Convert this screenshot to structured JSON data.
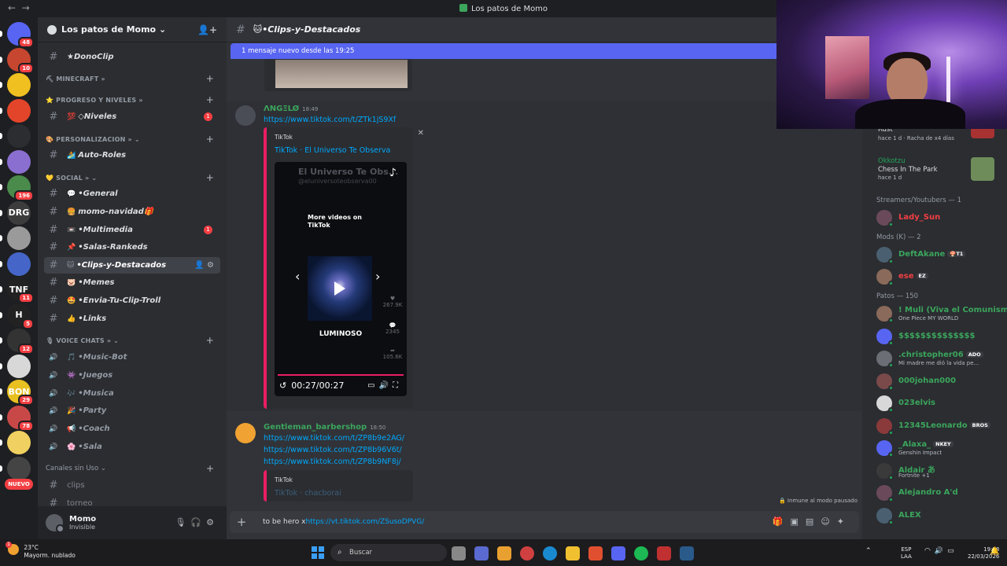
{
  "window": {
    "title": "Los patos de Momo"
  },
  "servers": [
    {
      "label": "",
      "badge": "48",
      "color": "#5865f2"
    },
    {
      "label": "",
      "badge": "10",
      "color": "#c7462f"
    },
    {
      "label": "",
      "badge": "",
      "color": "#f0c020"
    },
    {
      "label": "",
      "badge": "",
      "color": "#e3452a"
    },
    {
      "label": "",
      "badge": "",
      "color": "#2b2d31"
    },
    {
      "label": "",
      "badge": "",
      "color": "#8a6fd0"
    },
    {
      "label": "",
      "badge": "196",
      "color": "#4a8a4a"
    },
    {
      "label": "DRG",
      "badge": "",
      "color": "#3c3c3c"
    },
    {
      "label": "",
      "badge": "",
      "color": "#9a9a9a"
    },
    {
      "label": "",
      "badge": "",
      "color": "#4566c8"
    },
    {
      "label": "TNF",
      "badge": "11",
      "color": "#222"
    },
    {
      "label": "H",
      "badge": "5",
      "color": "#222"
    },
    {
      "label": "",
      "badge": "12",
      "color": "#333"
    },
    {
      "label": "",
      "badge": "",
      "color": "#d8d8d8"
    },
    {
      "label": "BON",
      "badge": "29",
      "color": "#e8c020"
    },
    {
      "label": "",
      "badge": "78",
      "color": "#c84848"
    },
    {
      "label": "",
      "badge": "",
      "color": "#f0d060"
    },
    {
      "label": "",
      "badge": "",
      "color": "#444"
    }
  ],
  "nuevo_label": "NUEVO",
  "guild": {
    "name": "Los patos de Momo ⌄"
  },
  "channels": {
    "items": [
      {
        "type": "text",
        "emoji": "",
        "name": "★DonoClip",
        "badge": ""
      },
      {
        "type": "cat",
        "name": "⛏ MINECRAFT »"
      },
      {
        "type": "cat",
        "name": "⭐ PROGRESO Y NIVELES »"
      },
      {
        "type": "text",
        "emoji": "💯",
        "name": "◇Niveles",
        "badge": "1"
      },
      {
        "type": "cat",
        "name": "🎨 PERSONALIZACION » ⌄"
      },
      {
        "type": "text",
        "emoji": "🏄",
        "name": "Auto-Roles",
        "badge": ""
      },
      {
        "type": "cat",
        "name": "💛 SOCIAL » ⌄"
      },
      {
        "type": "text",
        "emoji": "💬",
        "name": "•General",
        "badge": ""
      },
      {
        "type": "text",
        "emoji": "🍔",
        "name": "momo-navidad🎁",
        "badge": ""
      },
      {
        "type": "text",
        "emoji": "📼",
        "name": "•Multimedia",
        "badge": "1"
      },
      {
        "type": "text",
        "emoji": "📌",
        "name": "•Salas-Rankeds",
        "badge": ""
      },
      {
        "type": "text",
        "emoji": "🐱",
        "name": "•Clips-y-Destacados",
        "badge": "",
        "active": true
      },
      {
        "type": "text",
        "emoji": "🐷",
        "name": "•Memes",
        "badge": ""
      },
      {
        "type": "text",
        "emoji": "🤩",
        "name": "•Envia-Tu-Clip-Troll",
        "badge": ""
      },
      {
        "type": "text",
        "emoji": "👍",
        "name": "•Links",
        "badge": ""
      },
      {
        "type": "cat",
        "name": "🎙 VOICE CHATS » ⌄"
      },
      {
        "type": "voice",
        "emoji": "🎵",
        "name": "•Music-Bot"
      },
      {
        "type": "voice",
        "emoji": "👾",
        "name": "•Juegos"
      },
      {
        "type": "voice",
        "emoji": "🎶",
        "name": "•Musica"
      },
      {
        "type": "voice",
        "emoji": "🎉",
        "name": "•Party"
      },
      {
        "type": "voice",
        "emoji": "📢",
        "name": "•Coach"
      },
      {
        "type": "voice",
        "emoji": "🌸",
        "name": "•Sala"
      },
      {
        "type": "catplain",
        "name": "Canales sin Uso ⌄"
      },
      {
        "type": "text",
        "emoji": "",
        "name": "clips",
        "badge": "",
        "plain": true
      },
      {
        "type": "text",
        "emoji": "",
        "name": "torneo",
        "badge": "",
        "plain": true
      }
    ]
  },
  "user": {
    "name": "Momo",
    "status": "Invisible"
  },
  "channel_header": {
    "emoji": "🐱",
    "name": "•Clips-y-Destacados"
  },
  "new_messages_bar": "1 mensaje nuevo desde las 19:25",
  "messages": [
    {
      "author": "ΛNGΞLØ",
      "time": "18:49",
      "link": "https://www.tiktok.com/t/ZTk1jS9Xf",
      "embed": {
        "provider": "TikTok",
        "title": "TikTok · El Universo Te Observa",
        "video": {
          "title": "El Universo Te Obs...",
          "handle": "@eluniversoteobserva00",
          "more": "More videos on TikTok",
          "caption": "LUMINOSO",
          "likes": "267.9K",
          "comments": "2345",
          "shares": "105.6K",
          "time": "00:27/00:27",
          "progress": 1.0
        }
      }
    },
    {
      "author": "Gentleman_barbershop",
      "time": "18:50",
      "links": [
        "https://www.tiktok.com/t/ZP8b9e2AG/",
        "https://www.tiktok.com/t/ZP8b96V6t/",
        "https://www.tiktok.com/t/ZP8b9NF8j/"
      ],
      "embed": {
        "provider": "TikTok",
        "title": "TikTok · chacborai"
      }
    }
  ],
  "paused_notice": "Inmune al modo pausado",
  "composer": {
    "prefix": "to be hero x",
    "url": "https://vt.tiktok.com/ZSusoDPVG/"
  },
  "members": {
    "activity_cards": [
      {
        "name": "Rust",
        "game": "",
        "time": "hace 1 d",
        "extra": "Racha de x4 días"
      },
      {
        "name": "Okkotzu",
        "game": "Chess In The Park",
        "time": "hace 1 d"
      }
    ],
    "groups": [
      {
        "heading": "Streamers/Youtubers — 1",
        "members": [
          {
            "name": "Lady_Sun",
            "color": "#f23f43",
            "activity": "",
            "tag": ""
          }
        ]
      },
      {
        "heading": "Mods (K) — 2",
        "members": [
          {
            "name": "DeftAkane",
            "color": "#3ba55c",
            "activity": "",
            "tag": "🍄T1"
          },
          {
            "name": "ese",
            "color": "#f23f43",
            "activity": "",
            "tag": "EZ"
          }
        ]
      },
      {
        "heading": "Patos — 150",
        "members": [
          {
            "name": "! Muli (Viva el Comunismo)",
            "color": "#3ba55c",
            "activity": "One Piece MY WORLD",
            "tag": ""
          },
          {
            "name": "$$$$$$$$$$$$$$",
            "color": "#3ba55c",
            "activity": "",
            "tag": ""
          },
          {
            "name": ".christopher06",
            "color": "#3ba55c",
            "activity": "Mi madre me dió la vida pe...",
            "tag": "ADO"
          },
          {
            "name": "000johan000",
            "color": "#3ba55c",
            "activity": "",
            "tag": ""
          },
          {
            "name": "023elvis",
            "color": "#3ba55c",
            "activity": "",
            "tag": ""
          },
          {
            "name": "12345Leonardo",
            "color": "#3ba55c",
            "activity": "",
            "tag": "BROS"
          },
          {
            "name": "_Alaxa_",
            "color": "#3ba55c",
            "activity": "Genshin Impact",
            "tag": "NKEY"
          },
          {
            "name": "Aldair あ",
            "color": "#3ba55c",
            "activity": "Fortnite +1",
            "tag": ""
          },
          {
            "name": "Alejandro A'd",
            "color": "#3ba55c",
            "activity": "",
            "tag": ""
          },
          {
            "name": "ALEX",
            "color": "#3ba55c",
            "activity": "",
            "tag": ""
          }
        ]
      }
    ]
  },
  "taskbar": {
    "weather_temp": "23°C",
    "weather_desc": "Mayorm. nublado",
    "weather_badge": "1",
    "search_placeholder": "Buscar",
    "lang_top": "ESP",
    "lang_bottom": "LAA",
    "time": "19:28",
    "date": "22/03/2026"
  },
  "colors": {
    "accent": "#5865f2",
    "online": "#23a55a",
    "link": "#00a8fc",
    "embed_border": "#e91e63"
  }
}
